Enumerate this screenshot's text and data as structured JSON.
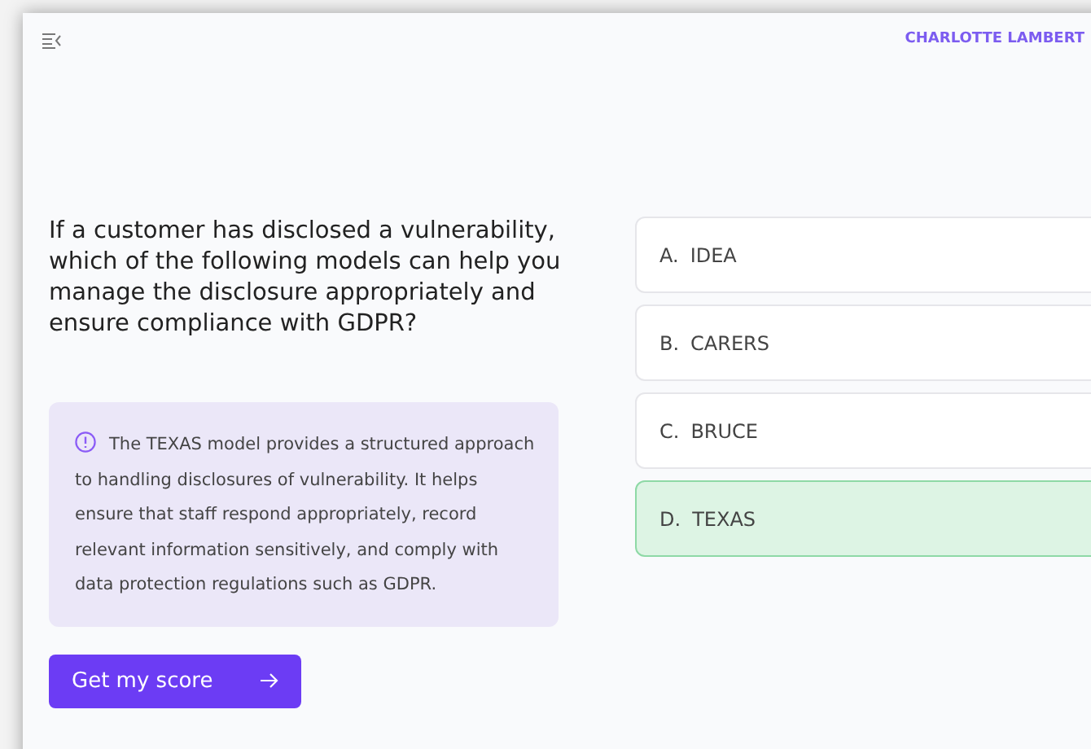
{
  "header": {
    "user_name": "CHARLOTTE LAMBERT"
  },
  "question": "If a customer has disclosed a vulnerability, which of the following models can help you manage the disclosure appropriately and ensure compliance with GDPR?",
  "explanation": "The TEXAS model provides a structured approach to handling disclosures of vulnerability. It helps ensure that staff respond appropriately, record relevant information sensitively, and comply with data protection regulations such as GDPR.",
  "options": [
    {
      "letter": "A.",
      "label": "IDEA",
      "selected": false
    },
    {
      "letter": "B.",
      "label": "CARERS",
      "selected": false
    },
    {
      "letter": "C.",
      "label": "BRUCE",
      "selected": false
    },
    {
      "letter": "D.",
      "label": "TEXAS",
      "selected": true
    }
  ],
  "submit_button": "Get my score"
}
